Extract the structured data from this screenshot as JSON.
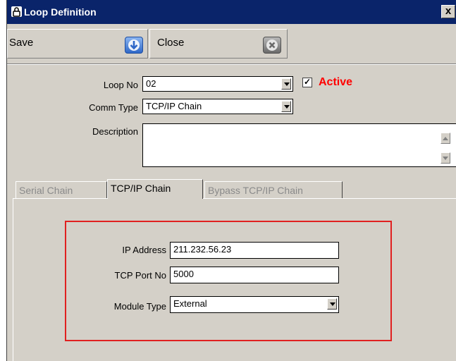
{
  "window": {
    "title": "Loop Definition",
    "close_glyph": "x"
  },
  "toolbar": {
    "save_label": "Save",
    "close_label": "Close"
  },
  "form": {
    "loop_no_label": "Loop No",
    "loop_no_value": "02",
    "active_label": "Active",
    "active_checked": true,
    "comm_type_label": "Comm Type",
    "comm_type_value": "TCP/IP Chain",
    "description_label": "Description",
    "description_value": ""
  },
  "tabs": [
    {
      "label": "Serial Chain",
      "enabled": false
    },
    {
      "label": "TCP/IP Chain",
      "enabled": true,
      "selected": true
    },
    {
      "label": "Bypass TCP/IP Chain",
      "enabled": false
    }
  ],
  "tcpip": {
    "ip_label": "IP Address",
    "ip_value": "211.232.56.23",
    "port_label": "TCP Port No",
    "port_value": "5000",
    "module_label": "Module Type",
    "module_value": "External"
  },
  "colors": {
    "titlebar": "#0a246a",
    "active": "#ff0000",
    "groupbox_border": "#e02020",
    "face": "#d4d0c8"
  },
  "icons": {
    "title": "padlock-icon",
    "save": "save-arrow-icon",
    "close": "close-x-icon"
  }
}
